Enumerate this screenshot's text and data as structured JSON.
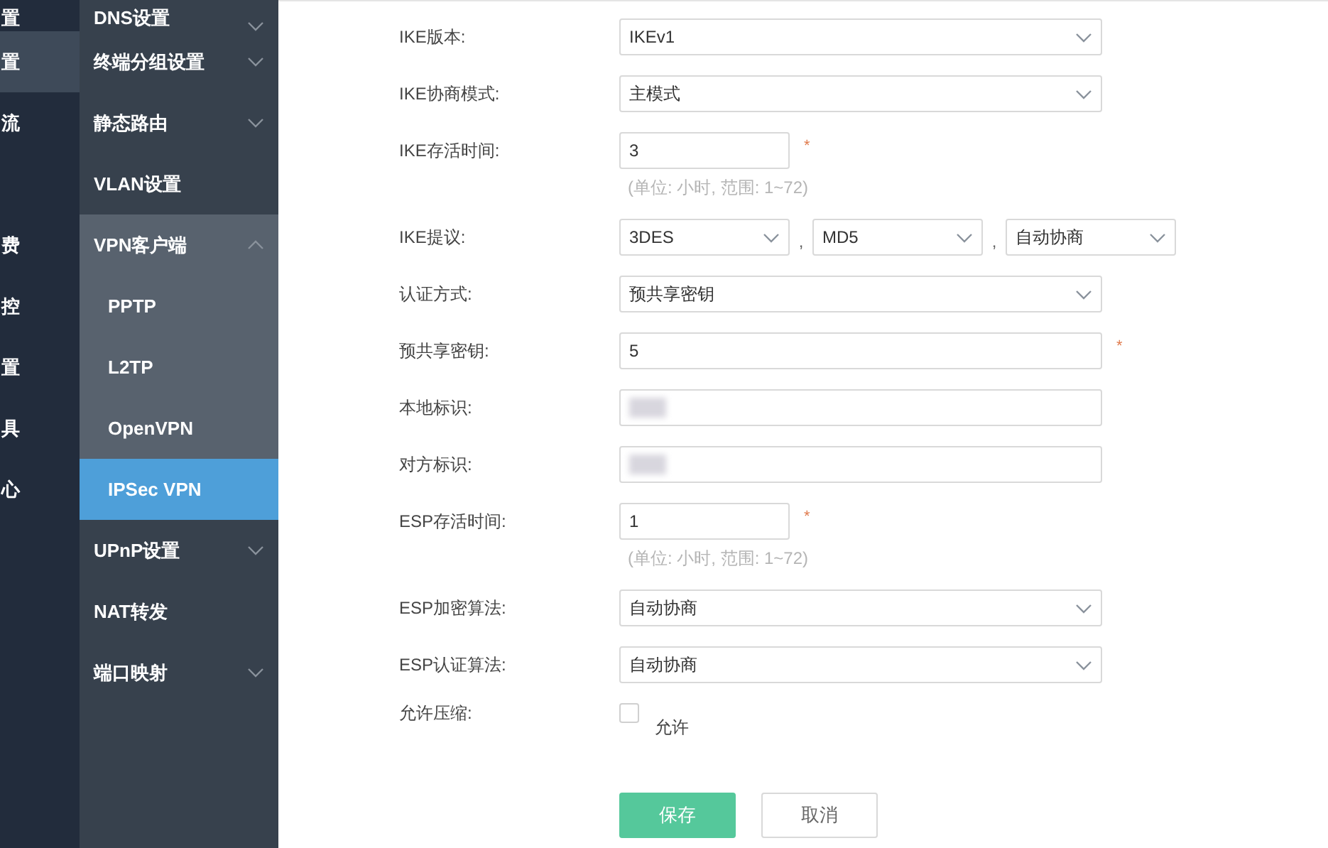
{
  "rail": {
    "items": [
      {
        "label": "置",
        "selected": false
      },
      {
        "label": "置",
        "selected": true
      },
      {
        "label": "流",
        "selected": false
      },
      {
        "selected": false
      },
      {
        "label": "费",
        "selected": false
      },
      {
        "label": "控",
        "selected": false
      },
      {
        "label": "置",
        "selected": false
      },
      {
        "label": "具",
        "selected": false
      },
      {
        "label": "心",
        "selected": false
      }
    ]
  },
  "menu": {
    "items": [
      {
        "label": "DNS设置",
        "expandable": true,
        "expanded": false
      },
      {
        "label": "终端分组设置",
        "expandable": true,
        "expanded": false
      },
      {
        "label": "静态路由",
        "expandable": true,
        "expanded": false
      },
      {
        "label": "VLAN设置",
        "expandable": false,
        "expanded": false
      },
      {
        "label": "VPN客户端",
        "expandable": true,
        "expanded": true,
        "children": [
          {
            "label": "PPTP",
            "selected": false
          },
          {
            "label": "L2TP",
            "selected": false
          },
          {
            "label": "OpenVPN",
            "selected": false
          },
          {
            "label": "IPSec VPN",
            "selected": true
          }
        ]
      },
      {
        "label": "UPnP设置",
        "expandable": true,
        "expanded": false
      },
      {
        "label": "NAT转发",
        "expandable": false,
        "expanded": false
      },
      {
        "label": "端口映射",
        "expandable": true,
        "expanded": false
      }
    ]
  },
  "form": {
    "rows": [
      {
        "kind": "select",
        "label": "IKE版本:",
        "value": "IKEv1"
      },
      {
        "kind": "select",
        "label": "IKE协商模式:",
        "value": "主模式"
      },
      {
        "kind": "short",
        "label": "IKE存活时间:",
        "value": "3",
        "required": "*",
        "hint": "(单位: 小时, 范围: 1~72)"
      },
      {
        "kind": "proposal",
        "label": "IKE提议:",
        "values": [
          "3DES",
          "MD5",
          "自动协商"
        ],
        "separators": [
          ",",
          ","
        ]
      },
      {
        "kind": "select",
        "label": "认证方式:",
        "value": "预共享密钥"
      },
      {
        "kind": "wide",
        "label": "预共享密钥:",
        "value": "5",
        "required": "*"
      },
      {
        "kind": "blurred",
        "label": "本地标识:"
      },
      {
        "kind": "blurred",
        "label": "对方标识:"
      },
      {
        "kind": "short",
        "label": "ESP存活时间:",
        "value": "1",
        "required": "*",
        "hint": "(单位: 小时, 范围: 1~72)"
      },
      {
        "kind": "select",
        "label": "ESP加密算法:",
        "value": "自动协商"
      },
      {
        "kind": "select",
        "label": "ESP认证算法:",
        "value": "自动协商"
      },
      {
        "kind": "checkbox",
        "label": "允许压缩:",
        "option": "允许",
        "checked": false
      }
    ],
    "buttons": [
      {
        "kind": "primary",
        "label": "保存"
      },
      {
        "kind": "secondary",
        "label": "取消"
      }
    ]
  }
}
